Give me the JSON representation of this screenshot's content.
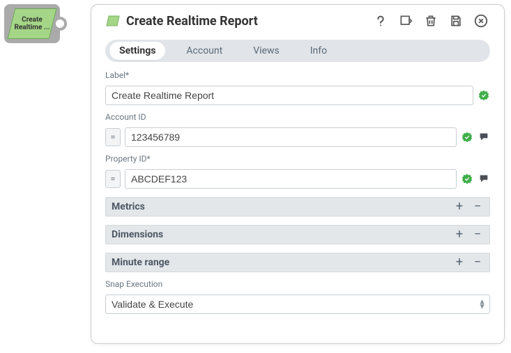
{
  "node": {
    "label": "Create Realtime ..."
  },
  "header": {
    "title": "Create Realtime Report"
  },
  "tabs": [
    {
      "label": "Settings",
      "active": true
    },
    {
      "label": "Account",
      "active": false
    },
    {
      "label": "Views",
      "active": false
    },
    {
      "label": "Info",
      "active": false
    }
  ],
  "fields": {
    "label": {
      "label": "Label*",
      "value": "Create Realtime Report"
    },
    "account_id": {
      "label": "Account ID",
      "value": "123456789"
    },
    "property_id": {
      "label": "Property ID*",
      "value": "ABCDEF123"
    }
  },
  "sections": {
    "metrics": "Metrics",
    "dimensions": "Dimensions",
    "minute_range": "Minute range"
  },
  "snap_execution": {
    "label": "Snap Execution",
    "value": "Validate & Execute"
  }
}
